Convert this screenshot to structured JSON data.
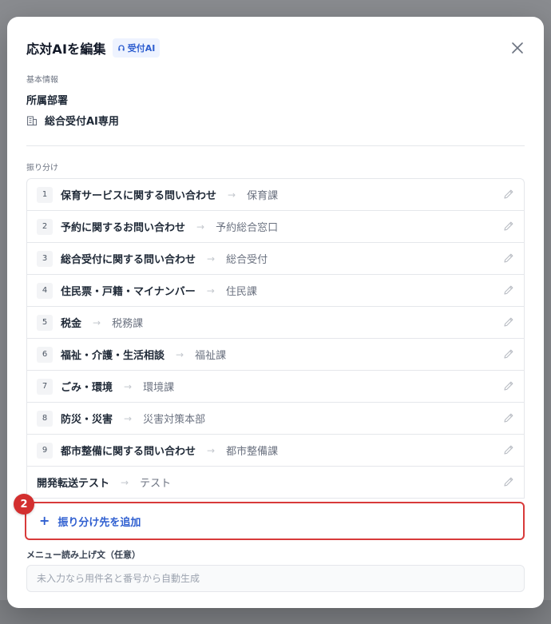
{
  "modal": {
    "title": "応対AIを編集",
    "badge": "受付AI"
  },
  "basic_info": {
    "section_label": "基本情報",
    "department_label": "所属部署",
    "department_value": "総合受付AI専用"
  },
  "routing": {
    "section_label": "振り分け",
    "rows": [
      {
        "num": "1",
        "name": "保育サービスに関する問い合わせ",
        "dest": "保育課"
      },
      {
        "num": "2",
        "name": "予約に関するお問い合わせ",
        "dest": "予約総合窓口"
      },
      {
        "num": "3",
        "name": "総合受付に関する問い合わせ",
        "dest": "総合受付"
      },
      {
        "num": "4",
        "name": "住民票・戸籍・マイナンバー",
        "dest": "住民課"
      },
      {
        "num": "5",
        "name": "税金",
        "dest": "税務課"
      },
      {
        "num": "6",
        "name": "福祉・介護・生活相談",
        "dest": "福祉課"
      },
      {
        "num": "7",
        "name": "ごみ・環境",
        "dest": "環境課"
      },
      {
        "num": "8",
        "name": "防災・災害",
        "dest": "災害対策本部"
      },
      {
        "num": "9",
        "name": "都市整備に関する問い合わせ",
        "dest": "都市整備課"
      },
      {
        "num": "",
        "name": "開発転送テスト",
        "dest": "テスト"
      }
    ],
    "add_label": "振り分け先を追加",
    "step_marker": "2"
  },
  "menu_text": {
    "label": "メニュー読み上げ文（任意）",
    "placeholder": "未入力なら用件名と番号から自動生成",
    "value": ""
  },
  "colors": {
    "accent": "#2f5fd0",
    "highlight": "#d83a3a"
  }
}
